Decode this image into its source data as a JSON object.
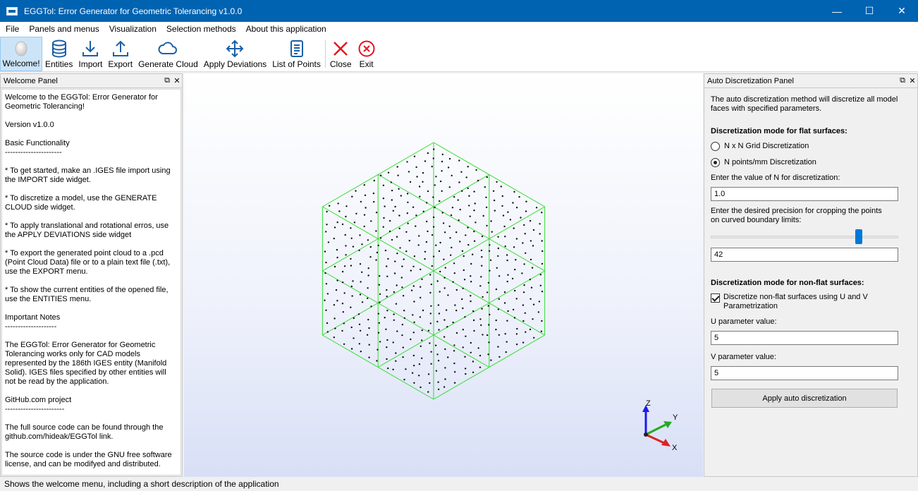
{
  "window": {
    "title": "EGGTol: Error Generator for Geometric Tolerancing v1.0.0",
    "controls": {
      "minimize": "—",
      "maximize": "☐",
      "close": "✕"
    }
  },
  "menu": [
    "File",
    "Panels and menus",
    "Visualization",
    "Selection methods",
    "About this application"
  ],
  "toolbar": [
    {
      "label": "Welcome!",
      "icon": "egg-icon",
      "active": true
    },
    {
      "label": "Entities",
      "icon": "database-icon"
    },
    {
      "label": "Import",
      "icon": "download-icon"
    },
    {
      "label": "Export",
      "icon": "upload-icon"
    },
    {
      "label": "Generate Cloud",
      "icon": "cloud-icon"
    },
    {
      "label": "Apply Deviations",
      "icon": "move-arrows-icon"
    },
    {
      "label": "List of Points",
      "icon": "list-document-icon"
    },
    {
      "label": "Close",
      "icon": "close-x-icon"
    },
    {
      "label": "Exit",
      "icon": "exit-circle-icon"
    }
  ],
  "colors": {
    "accent": "#0063b1",
    "mesh": "#33dd33",
    "close": "#e81123",
    "slider": "#0078d7"
  },
  "welcome_panel": {
    "title": "Welcome Panel",
    "paragraphs": [
      "Welcome to the EGGTol: Error Generator for Geometric Tolerancing!",
      "Version v1.0.0",
      "Basic Functionality\n----------------------",
      "* To get started, make an .IGES file import using the IMPORT side widget.",
      "* To discretize a model, use the GENERATE CLOUD side widget.",
      "* To apply translational and rotational erros, use the APPLY DEVIATIONS side widget",
      "* To export the generated point cloud to a .pcd (Point Cloud Data) file or to a plain text file (.txt), use the EXPORT menu.",
      "* To show the current entities of the opened file, use the ENTITIES menu.",
      "Important Notes\n--------------------",
      "The EGGTol: Error Generator for Geometric Tolerancing works only for CAD models represented by the 186th IGES entity (Manifold Solid). IGES files specified by other entities will not be read by the application.",
      "GitHub.com project\n-----------------------",
      "The full source code can be found through the github.com/hideak/EGGTol link.",
      "The source code is under the GNU free software license, and can be modifyed and distributed."
    ]
  },
  "auto_panel": {
    "title": "Auto Discretization Panel",
    "description": "The auto discretization method will discretize all model faces with specified parameters.",
    "flat_heading": "Discretization mode for flat surfaces:",
    "radio_grid": "N x N Grid Discretization",
    "radio_points": "N points/mm Discretization",
    "selected_mode": "N points/mm Discretization",
    "n_label": "Enter the value of N for discretization:",
    "n_value": "1.0",
    "precision_label": "Enter the desired precision for cropping the points\non curved boundary limits:",
    "precision_slider_fraction": 0.8,
    "precision_value": "42",
    "nonflat_heading": "Discretization mode for non-flat surfaces:",
    "checkbox_label": "Discretize non-flat surfaces using U and V Parametrization",
    "checkbox_checked": true,
    "u_label": "U parameter value:",
    "u_value": "5",
    "v_label": "V parameter value:",
    "v_value": "5",
    "apply_label": "Apply auto discretization"
  },
  "viewport": {
    "axes": {
      "z": "Z",
      "y": "Y",
      "x": "X"
    }
  },
  "status": "Shows the welcome menu, including a short description of the application"
}
